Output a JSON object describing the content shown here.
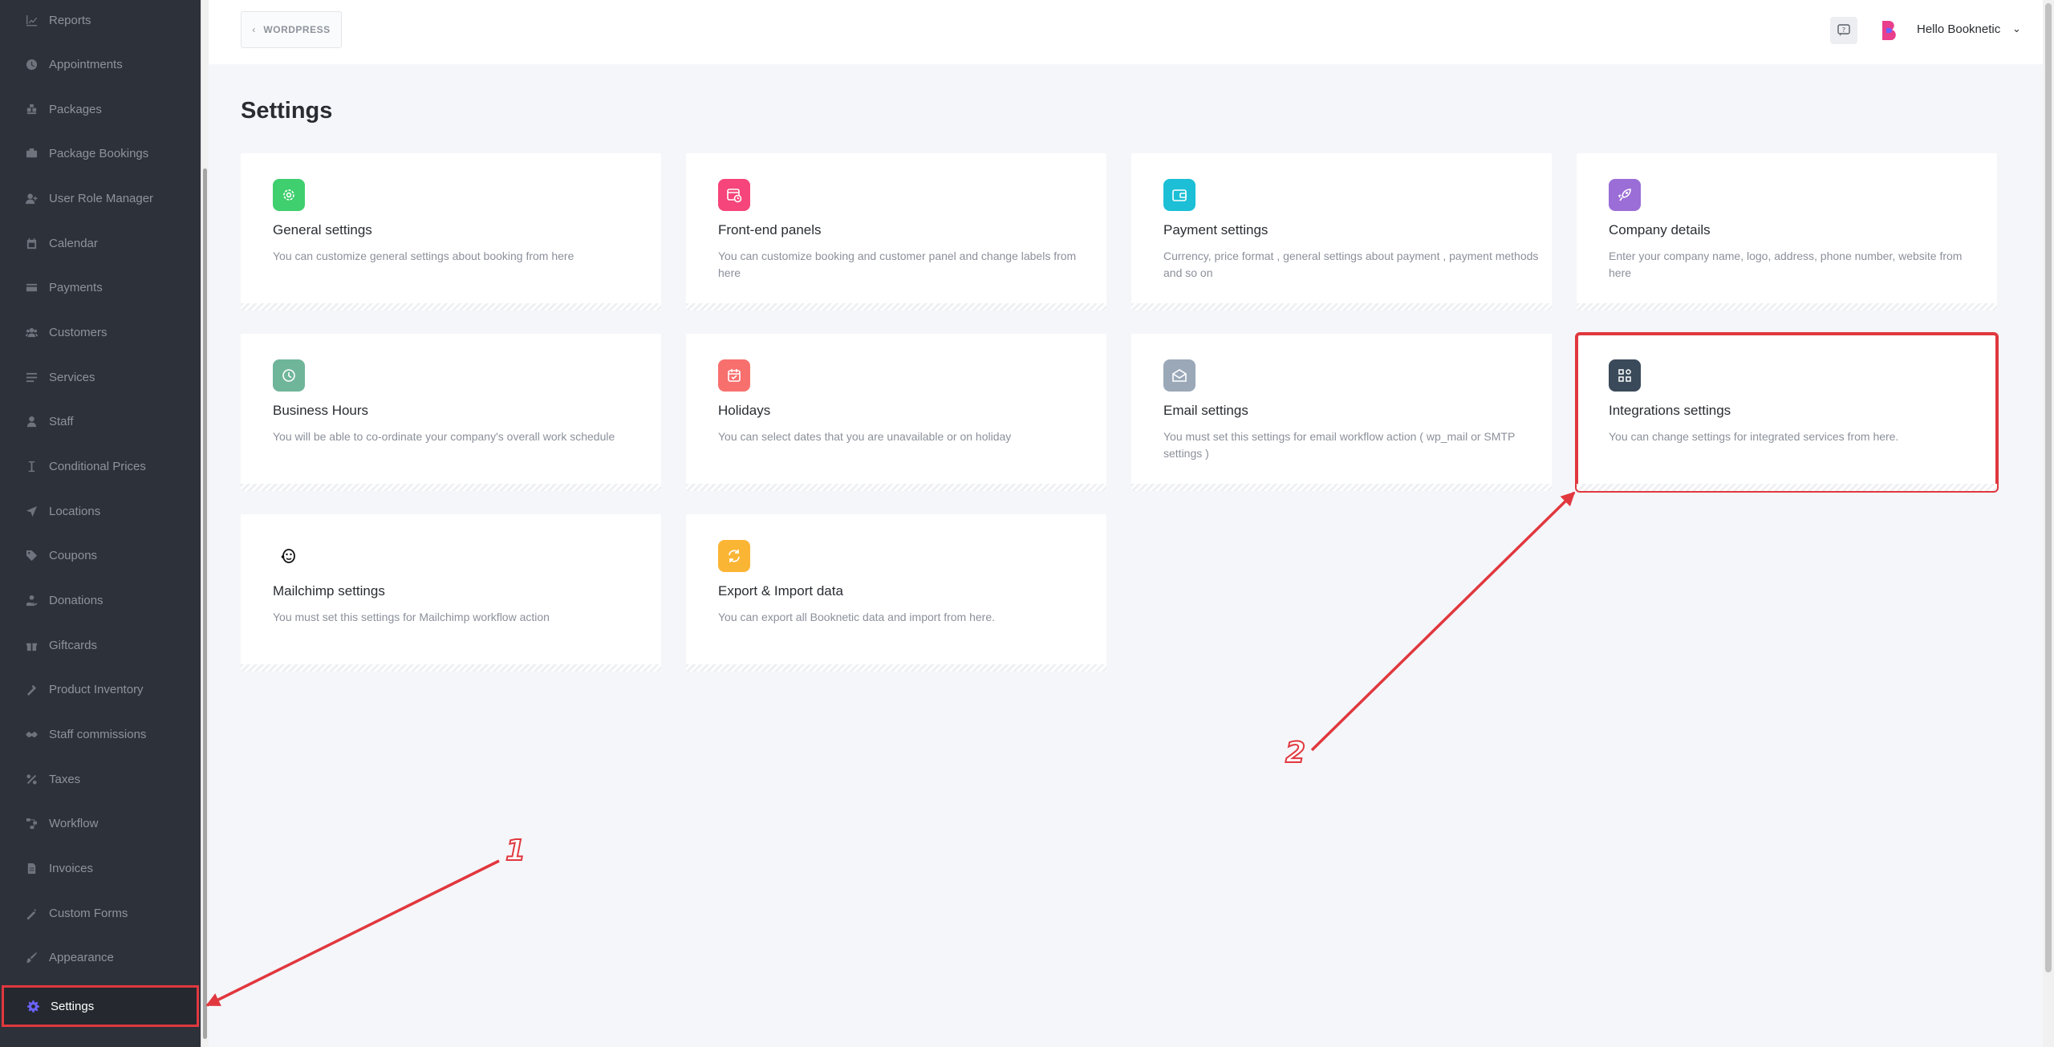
{
  "sidebar": {
    "items": [
      {
        "label": "Reports",
        "icon": "reports-icon"
      },
      {
        "label": "Appointments",
        "icon": "clock-icon"
      },
      {
        "label": "Packages",
        "icon": "packages-icon"
      },
      {
        "label": "Package Bookings",
        "icon": "package-bookings-icon"
      },
      {
        "label": "User Role Manager",
        "icon": "user-role-icon"
      },
      {
        "label": "Calendar",
        "icon": "calendar-icon"
      },
      {
        "label": "Payments",
        "icon": "payments-icon"
      },
      {
        "label": "Customers",
        "icon": "customers-icon"
      },
      {
        "label": "Services",
        "icon": "services-icon"
      },
      {
        "label": "Staff",
        "icon": "staff-icon"
      },
      {
        "label": "Conditional Prices",
        "icon": "conditional-prices-icon"
      },
      {
        "label": "Locations",
        "icon": "location-arrow-icon"
      },
      {
        "label": "Coupons",
        "icon": "tag-icon"
      },
      {
        "label": "Donations",
        "icon": "donations-icon"
      },
      {
        "label": "Giftcards",
        "icon": "gift-icon"
      },
      {
        "label": "Product Inventory",
        "icon": "inventory-icon"
      },
      {
        "label": "Staff commissions",
        "icon": "commission-icon"
      },
      {
        "label": "Taxes",
        "icon": "percent-icon"
      },
      {
        "label": "Workflow",
        "icon": "workflow-icon"
      },
      {
        "label": "Invoices",
        "icon": "invoice-icon"
      },
      {
        "label": "Custom Forms",
        "icon": "custom-forms-icon"
      },
      {
        "label": "Appearance",
        "icon": "brush-icon"
      },
      {
        "label": "Settings",
        "icon": "gear-icon",
        "active": true
      }
    ]
  },
  "topbar": {
    "back_label": "WORDPRESS",
    "user_greeting": "Hello Booknetic"
  },
  "page": {
    "title": "Settings"
  },
  "cards": [
    {
      "title": "General settings",
      "desc": "You can customize general settings about booking from here",
      "icon": "gear-icon",
      "color": "#3fcf6e"
    },
    {
      "title": "Front-end panels",
      "desc": "You can customize booking and customer panel and change labels from here",
      "icon": "calendar-clock-icon",
      "color": "#f5457a"
    },
    {
      "title": "Payment settings",
      "desc": "Currency, price format , general settings about payment , payment methods and so on",
      "icon": "wallet-icon",
      "color": "#1cbfd6"
    },
    {
      "title": "Company details",
      "desc": "Enter your company name, logo, address, phone number, website from here",
      "icon": "rocket-icon",
      "color": "#9b6dd6"
    },
    {
      "title": "Business Hours",
      "desc": "You will be able to co-ordinate your company's overall work schedule",
      "icon": "clock-icon",
      "color": "#6fb59a"
    },
    {
      "title": "Holidays",
      "desc": "You can select dates that you are unavailable or on holiday",
      "icon": "calendar-check-icon",
      "color": "#f7706e"
    },
    {
      "title": "Email settings",
      "desc": "You must set this settings for email workflow action ( wp_mail or SMTP settings )",
      "icon": "envelope-open-icon",
      "color": "#9aa8b8"
    },
    {
      "title": "Integrations settings",
      "desc": "You can change settings for integrated services from here.",
      "icon": "integrations-icon",
      "color": "#3b4a5a"
    },
    {
      "title": "Mailchimp settings",
      "desc": "You must set this settings for Mailchimp workflow action",
      "icon": "mailchimp-icon",
      "color": "#ffffff"
    },
    {
      "title": "Export & Import data",
      "desc": "You can export all Booknetic data and import from here.",
      "icon": "sync-icon",
      "color": "#fbb535"
    }
  ],
  "annotations": [
    {
      "label": "1"
    },
    {
      "label": "2"
    }
  ],
  "colors": {
    "sidebar_bg": "#2d3139",
    "highlight": "#e0383e",
    "active_icon": "#6c63ff"
  }
}
